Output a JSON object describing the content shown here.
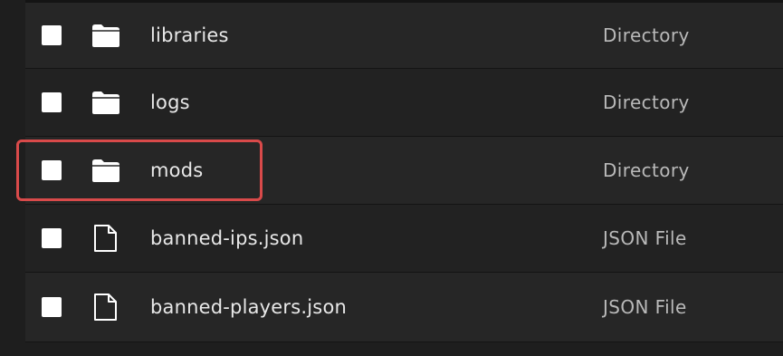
{
  "files": [
    {
      "name": "libraries",
      "type": "Directory",
      "icon": "folder-icon"
    },
    {
      "name": "logs",
      "type": "Directory",
      "icon": "folder-icon"
    },
    {
      "name": "mods",
      "type": "Directory",
      "icon": "folder-icon",
      "highlighted": true
    },
    {
      "name": "banned-ips.json",
      "type": "JSON File",
      "icon": "file-icon"
    },
    {
      "name": "banned-players.json",
      "type": "JSON File",
      "icon": "file-icon"
    }
  ],
  "colors": {
    "background": "#1e1e1e",
    "row_alt_a": "#262626",
    "row_alt_b": "#222222",
    "highlight": "#d94a4a",
    "text": "#e8e8e8",
    "subtext": "#b9b9b9"
  }
}
